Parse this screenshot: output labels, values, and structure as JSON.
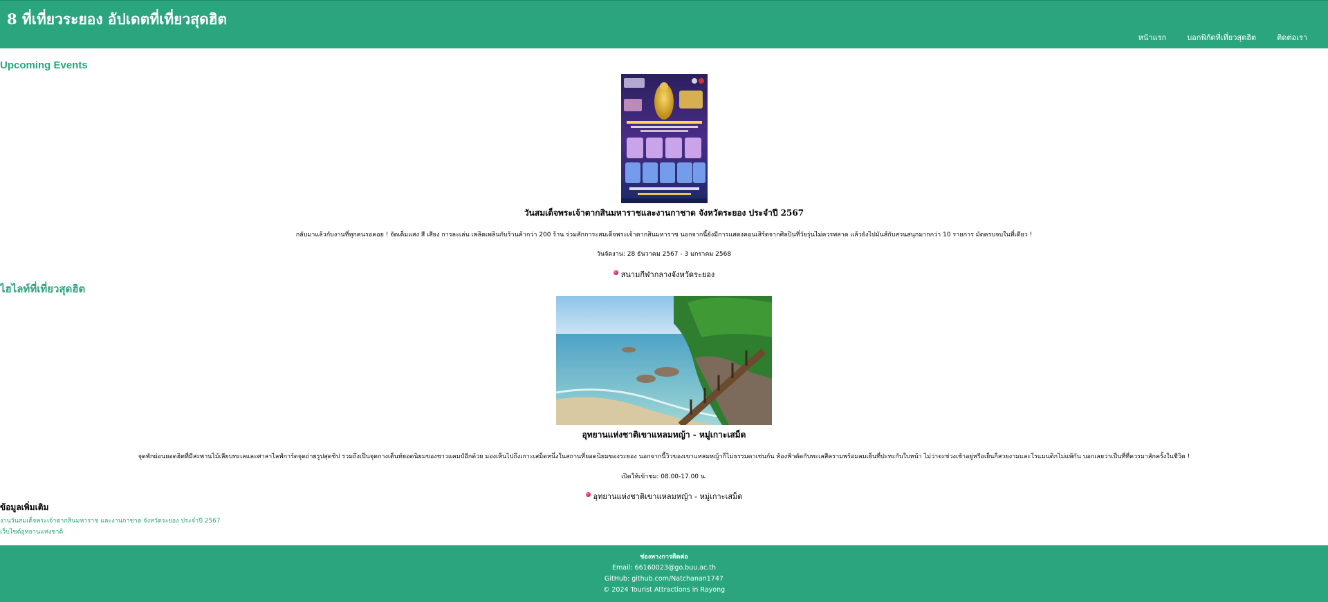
{
  "header": {
    "site_title": "8 ที่เที่ยวระยอง อัปเดตที่เที่ยวสุดฮิต",
    "nav": [
      {
        "label": "หน้าแรก"
      },
      {
        "label": "บอกพิกัดที่เที่ยวสุดฮิต"
      },
      {
        "label": "ติดต่อเรา"
      }
    ]
  },
  "events": {
    "heading": "Upcoming Events",
    "item": {
      "title": "วันสมเด็จพระเจ้าตากสินมหาราชและงานกาชาด จังหวัดระยอง ประจำปี 2567",
      "description": "กลับมาแล้วกับงานที่ทุกคนรอคอย ! จัดเต็มแสง สี เสียง การละเล่น เพลิดเพลินกับร้านค้ากว่า 200 ร้าน ร่วมสักการะสมเด็จพระเจ้าตากสินมหาราช นอกจากนี้ยังมีการแสดงคอนเสิร์ตจากศิลปินที่วัยรุ่นไม่ควรพลาด แล้วยังไปมันส์กับสวนสนุกมากกว่า 10 รายการ มัดครบจบในที่เดียว !",
      "date": "วันจัดงาน: 28 ธันวาคม 2567 - 3 มกราคม 2568",
      "location": "สนามกีฬากลางจังหวัดระยอง"
    }
  },
  "highlights": {
    "heading": "ไฮไลท์ที่เที่ยวสุดฮิต",
    "item": {
      "title": "อุทยานแห่งชาติเขาแหลมหญ้า - หมู่เกาะเสม็ด",
      "description": "จุดพักผ่อนยอดฮิตที่มีสะพานไม้เลียบทะเลและศาลาไลฟ์การ์ดจุดถ่ายรูปสุดชิป รวมถึงเป็นจุดกางเต็นท์ยอดนิยมของชาวแคมป์อีกด้วย มองเห็นไปถึงเกาะเสม็ดหนึ่งในสถานที่ยอดนิยมของระยอง นอกจากนี้วิวของเขาแหลมหญ้าก็ไม่ธรรมดาเช่นกัน ท้องฟ้าตัดกับทะเลสีครามพร้อมลมเย็นที่ปะทะกับใบหน้า ไม่ว่าจะช่วงเช้าอยู่หรือเย็นก็สวยงามและโรแมนติกไม่แพ้กัน บอกเลยว่าเป็นที่ที่ควรมาสักครั้งในชีวิต !",
      "hours": "เปิดให้เข้าชม: 08.00-17.00 น.",
      "location": "อุทยานแห่งชาติเขาแหลมหญ้า - หมู่เกาะเสม็ด"
    }
  },
  "more_info": {
    "heading": "ข้อมูลเพิ่มเติม",
    "links": [
      {
        "label": "งานวันสมเด็จพระเจ้าตากสินมหาราช และงานกาชาด จังหวัดระยอง ประจำปี 2567"
      },
      {
        "label": "เว็บไซต์อุทยานแห่งชาติ"
      }
    ]
  },
  "footer": {
    "heading": "ช่องทางการติดต่อ",
    "email": "Email: 66160023@go.buu.ac.th",
    "github": "GitHub: github.com/Natchanan1747",
    "copyright": "© 2024 Tourist Attractions in Rayong"
  },
  "colors": {
    "brand": "#2aa57d",
    "pin": "#d0105e"
  }
}
